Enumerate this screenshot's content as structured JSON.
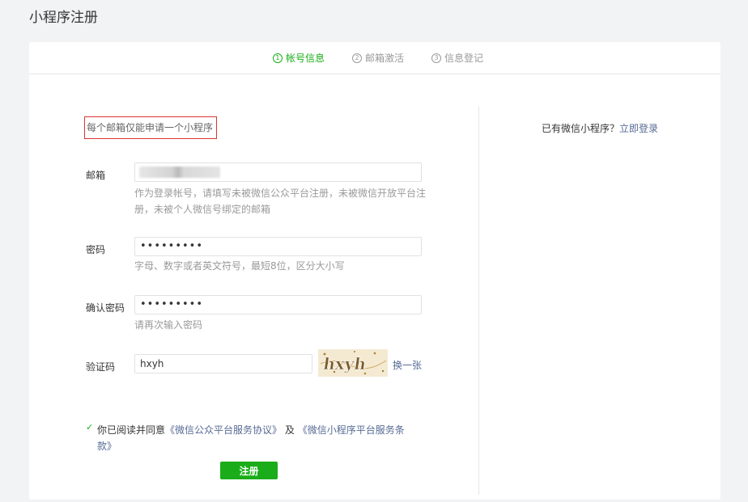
{
  "page_title": "小程序注册",
  "steps": [
    {
      "num": "1",
      "label": "帐号信息",
      "active": true
    },
    {
      "num": "2",
      "label": "邮箱激活",
      "active": false
    },
    {
      "num": "3",
      "label": "信息登记",
      "active": false
    }
  ],
  "notice": "每个邮箱仅能申请一个小程序",
  "login_hint": {
    "text": "已有微信小程序？",
    "link": "立即登录"
  },
  "form": {
    "email": {
      "label": "邮箱",
      "value": "",
      "help": "作为登录帐号，请填写未被微信公众平台注册，未被微信开放平台注册，未被个人微信号绑定的邮箱"
    },
    "password": {
      "label": "密码",
      "value": "•••••••••",
      "help": "字母、数字或者英文符号，最短8位，区分大小写"
    },
    "confirm_password": {
      "label": "确认密码",
      "value": "•••••••••",
      "help": "请再次输入密码"
    },
    "captcha": {
      "label": "验证码",
      "value": "hxyh",
      "image_text": "hxyh",
      "refresh": "换一张"
    }
  },
  "agreement": {
    "prefix": "你已阅读并同意",
    "link1": "《微信公众平台服务协议》",
    "middle": "及",
    "link2": "《微信小程序平台服务条款》"
  },
  "submit_label": "注册",
  "colors": {
    "accent": "#1aad19",
    "link": "#576b95",
    "notice_border": "#dd3333"
  }
}
